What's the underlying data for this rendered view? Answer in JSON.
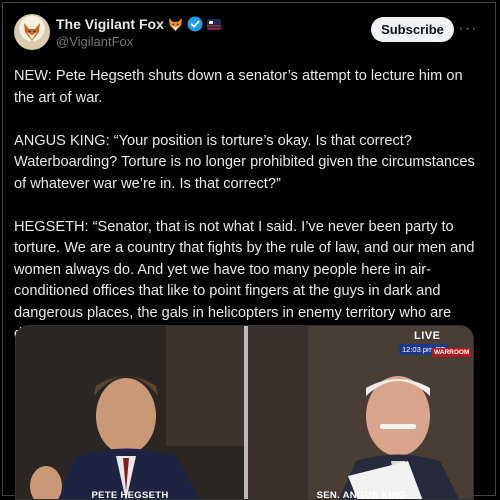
{
  "author": {
    "display_name": "The Vigilant Fox",
    "handle": "@VigilantFox",
    "badges": [
      "fox-emoji",
      "verified-check",
      "affiliate-flag"
    ]
  },
  "actions": {
    "subscribe_label": "Subscribe",
    "more_label": "···"
  },
  "post": {
    "paragraphs": [
      "NEW: Pete Hegseth shuts down a senator’s attempt to lecture him on the art of war.",
      "ANGUS KING: “Your position is torture’s okay. Is that correct? Waterboarding? Torture is no longer prohibited given the circumstances of whatever war we’re in. Is that correct?”",
      "HEGSETH: “Senator, that is not what I said. I’ve never been party to torture. We are a country that fights by the rule of law, and our men and women always do. And yet we have too many people here in air-conditioned offices that like to point fingers at the guys in dark and dangerous places, the gals in helicopters in enemy territory who are doing things that people in Washington, D.C., would never dare to do.”"
    ]
  },
  "media": {
    "live_label": "LIVE",
    "live_time": "12:03 pm ET",
    "network_label": "WARROOM",
    "caption_left": "PETE HEGSETH",
    "caption_right": "SEN. ANGUS KING"
  },
  "colors": {
    "background": "#000000",
    "text": "#e7e9ea",
    "muted": "#71767b",
    "verified": "#1d9bf0",
    "subscribe_bg": "#eff3f4"
  }
}
